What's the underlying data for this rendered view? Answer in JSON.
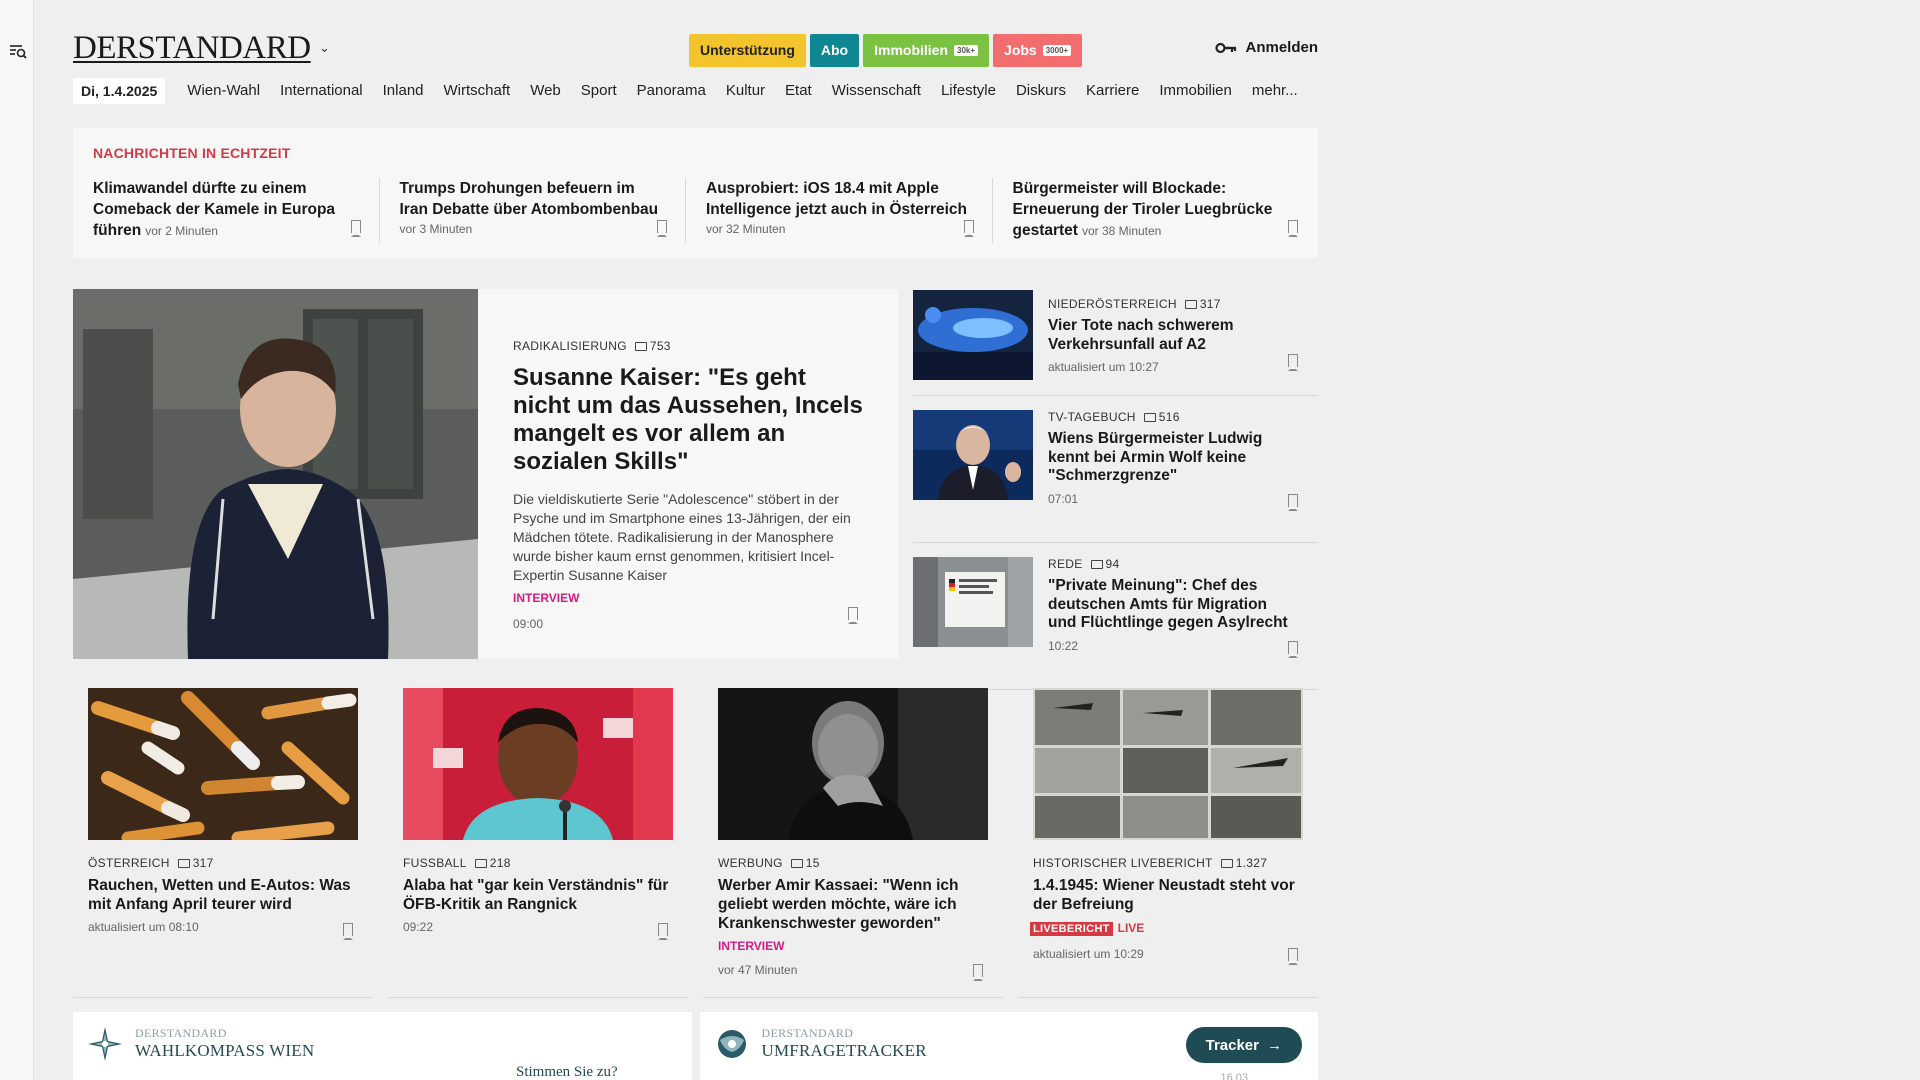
{
  "header": {
    "logo": "DERSTANDARD",
    "pills": [
      {
        "label": "Unterstützung",
        "tag": ""
      },
      {
        "label": "Abo",
        "tag": ""
      },
      {
        "label": "Immobilien",
        "tag": "30k+"
      },
      {
        "label": "Jobs",
        "tag": "3000+"
      }
    ],
    "login_label": "Anmelden"
  },
  "nav": {
    "date": "Di, 1.4.2025",
    "items": [
      "Wien-Wahl",
      "International",
      "Inland",
      "Wirtschaft",
      "Web",
      "Sport",
      "Panorama",
      "Kultur",
      "Etat",
      "Wissenschaft",
      "Lifestyle",
      "Diskurs",
      "Karriere",
      "Immobilien",
      "mehr..."
    ]
  },
  "ticker": {
    "title": "NACHRICHTEN IN ECHTZEIT",
    "items": [
      {
        "headline": "Klimawandel dürfte zu einem Comeback der Kamele in Europa führen",
        "time": "vor 2 Minuten"
      },
      {
        "headline": "Trumps Drohungen befeuern im Iran Debatte über Atombombenbau",
        "time": "vor 3 Minuten"
      },
      {
        "headline": "Ausprobiert: iOS 18.4 mit Apple Intelligence jetzt auch in Österreich",
        "time": "vor 32 Minuten"
      },
      {
        "headline": "Bürgermeister will Blockade: Erneuerung der Tiroler Luegbrücke gestartet",
        "time": "vor 38 Minuten"
      }
    ]
  },
  "main_story": {
    "kicker": "RADIKALISIERUNG",
    "comments": "753",
    "title": "Susanne Kaiser: \"Es geht nicht um das Aussehen, Incels mangelt es vor allem an sozialen Skills\"",
    "teaser": "Die vieldiskutierte Serie \"Adolescence\" stöbert in der Psyche und im Smartphone eines 13-Jährigen, der ein Mädchen tötete. Radikalisierung in der Manosphere wurde bisher kaum ernst genommen, kritisiert Incel-Expertin Susanne Kaiser",
    "tag": "INTERVIEW",
    "time": "09:00"
  },
  "side_stories": [
    {
      "kicker": "NIEDERÖSTERREICH",
      "comments": "317",
      "title": "Vier Tote nach schwerem Verkehrsunfall auf A2",
      "time": "aktualisiert um 10:27"
    },
    {
      "kicker": "TV-TAGEBUCH",
      "comments": "516",
      "title": "Wiens Bürgermeister Ludwig kennt bei Armin Wolf keine \"Schmerzgrenze\"",
      "time": "07:01"
    },
    {
      "kicker": "REDE",
      "comments": "94",
      "title": "\"Private Meinung\": Chef des deutschen Amts für Migration und Flüchtlinge gegen Asylrecht",
      "time": "10:22"
    }
  ],
  "cards": [
    {
      "kicker": "ÖSTERREICH",
      "comments": "317",
      "title": "Rauchen, Wetten und E-Autos: Was mit Anfang April teurer wird",
      "tag": "",
      "live": "",
      "live2": "",
      "time": "aktualisiert um 08:10"
    },
    {
      "kicker": "FUSSBALL",
      "comments": "218",
      "title": "Alaba hat \"gar kein Verständnis\" für ÖFB-Kritik an Rangnick",
      "tag": "",
      "live": "",
      "live2": "",
      "time": "09:22"
    },
    {
      "kicker": "WERBUNG",
      "comments": "15",
      "title": "Werber Amir Kassaei: \"Wenn ich geliebt werden möchte, wäre ich Krankenschwester geworden\"",
      "tag": "INTERVIEW",
      "live": "",
      "live2": "",
      "time": "vor 47 Minuten"
    },
    {
      "kicker": "HISTORISCHER LIVEBERICHT",
      "comments": "1.327",
      "title": "1.4.1945: Wiener Neustadt steht vor der Befreiung",
      "tag": "",
      "live": "LIVEBERICHT",
      "live2": "LIVE",
      "time": "aktualisiert um 10:29"
    }
  ],
  "widgets": {
    "left": {
      "brand": "DERSTANDARD",
      "name": "WAHLKOMPASS WIEN",
      "question": "Stimmen Sie zu?"
    },
    "right": {
      "brand": "DERSTANDARD",
      "name": "UMFRAGETRACKER",
      "button": "Tracker",
      "small": "16.03"
    }
  }
}
